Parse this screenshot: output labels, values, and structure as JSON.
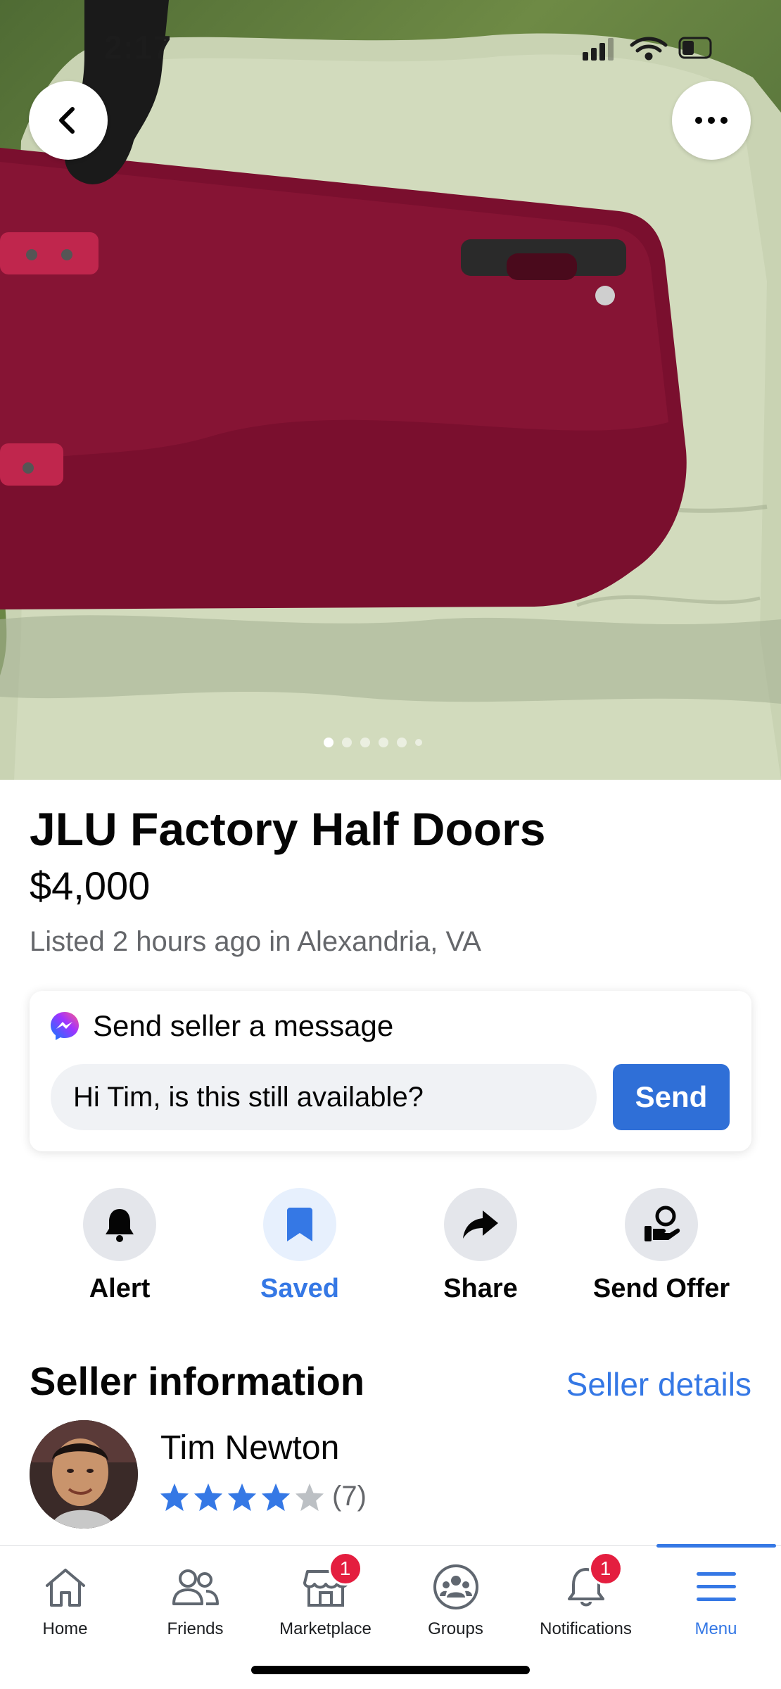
{
  "status_bar": {
    "time": "2:17"
  },
  "hero": {
    "image_description_icon": "photo-carousel",
    "page_count": 6,
    "current_page": 1
  },
  "listing": {
    "title": "JLU Factory Half Doors",
    "price": "$4,000",
    "listed": "Listed 2 hours ago in Alexandria, VA"
  },
  "message": {
    "heading": "Send seller a message",
    "input_value": "Hi Tim, is this still available?",
    "send_label": "Send"
  },
  "actions": [
    {
      "label": "Alert",
      "icon": "bell-icon",
      "active": false
    },
    {
      "label": "Saved",
      "icon": "bookmark-icon",
      "active": true
    },
    {
      "label": "Share",
      "icon": "share-arrow-icon",
      "active": false
    },
    {
      "label": "Send Offer",
      "icon": "offer-hand-icon",
      "active": false
    }
  ],
  "seller": {
    "heading": "Seller information",
    "details_link": "Seller details",
    "name": "Tim Newton",
    "rating_stars": 4,
    "rating_max": 5,
    "rating_count": "(7)"
  },
  "tabs": [
    {
      "label": "Home",
      "icon": "home-icon",
      "badge": ""
    },
    {
      "label": "Friends",
      "icon": "friends-icon",
      "badge": ""
    },
    {
      "label": "Marketplace",
      "icon": "marketplace-icon",
      "badge": "1"
    },
    {
      "label": "Groups",
      "icon": "groups-icon",
      "badge": ""
    },
    {
      "label": "Notifications",
      "icon": "bell-icon",
      "badge": "1"
    },
    {
      "label": "Menu",
      "icon": "menu-icon",
      "badge": "",
      "active": true
    }
  ],
  "colors": {
    "accent": "#3578e5",
    "send_button": "#2f6fd7",
    "badge": "#e41e3f",
    "door": "#7a0f2e"
  }
}
